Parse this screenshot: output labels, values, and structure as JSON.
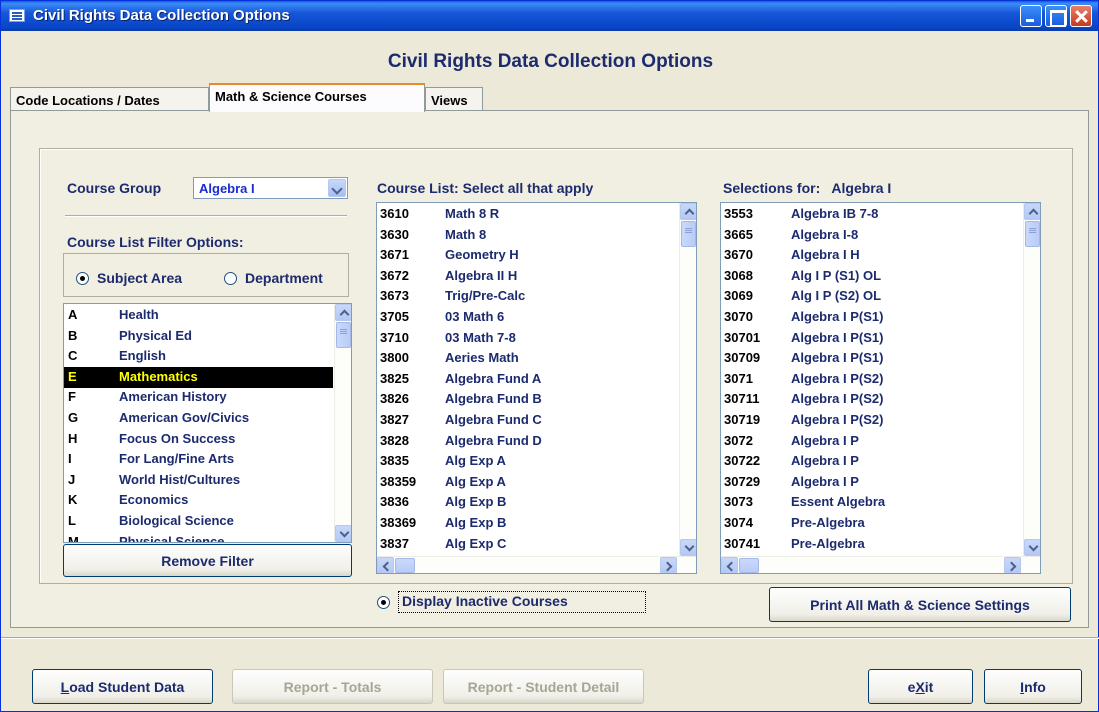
{
  "window": {
    "title": "Civil Rights Data Collection Options"
  },
  "form_title": "Civil Rights Data Collection Options",
  "tabs": [
    {
      "label": "Code Locations / Dates"
    },
    {
      "label": "Math & Science Courses",
      "active": true
    },
    {
      "label": "Views"
    }
  ],
  "course_group": {
    "label": "Course Group",
    "value": "Algebra I"
  },
  "filter": {
    "label": "Course List Filter Options:",
    "subject_area": "Subject Area",
    "department": "Department",
    "selected": "Subject Area",
    "items": [
      {
        "code": "A",
        "name": "Health"
      },
      {
        "code": "B",
        "name": "Physical Ed"
      },
      {
        "code": "C",
        "name": "English"
      },
      {
        "code": "E",
        "name": "Mathematics",
        "selected": true
      },
      {
        "code": "F",
        "name": "American History"
      },
      {
        "code": "G",
        "name": "American Gov/Civics"
      },
      {
        "code": "H",
        "name": "Focus On Success"
      },
      {
        "code": "I",
        "name": "For Lang/Fine Arts"
      },
      {
        "code": "J",
        "name": "World Hist/Cultures"
      },
      {
        "code": "K",
        "name": "Economics"
      },
      {
        "code": "L",
        "name": "Biological Science"
      },
      {
        "code": "M",
        "name": "Physical Science"
      }
    ],
    "remove_filter": "Remove Filter"
  },
  "course_list": {
    "label": "Course List: Select all that apply",
    "items": [
      {
        "code": "3610",
        "name": "Math 8 R"
      },
      {
        "code": "3630",
        "name": "Math 8"
      },
      {
        "code": "3671",
        "name": "Geometry H"
      },
      {
        "code": "3672",
        "name": "Algebra II H"
      },
      {
        "code": "3673",
        "name": "Trig/Pre-Calc"
      },
      {
        "code": "3705",
        "name": "03 Math 6"
      },
      {
        "code": "3710",
        "name": "03 Math 7-8"
      },
      {
        "code": "3800",
        "name": "Aeries Math"
      },
      {
        "code": "3825",
        "name": "Algebra Fund A"
      },
      {
        "code": "3826",
        "name": "Algebra Fund B"
      },
      {
        "code": "3827",
        "name": "Algebra Fund C"
      },
      {
        "code": "3828",
        "name": "Algebra Fund D"
      },
      {
        "code": "3835",
        "name": "Alg Exp A"
      },
      {
        "code": "38359",
        "name": "Alg Exp A"
      },
      {
        "code": "3836",
        "name": "Alg Exp B"
      },
      {
        "code": "38369",
        "name": "Alg Exp B"
      },
      {
        "code": "3837",
        "name": "Alg Exp C"
      }
    ]
  },
  "selections": {
    "label": "Selections for:",
    "group": "Algebra I",
    "items": [
      {
        "code": "3553",
        "name": "Algebra IB 7-8"
      },
      {
        "code": "3665",
        "name": "Algebra I-8"
      },
      {
        "code": "3670",
        "name": "Algebra I H"
      },
      {
        "code": "3068",
        "name": "Alg I P (S1) OL"
      },
      {
        "code": "3069",
        "name": "Alg I P (S2) OL"
      },
      {
        "code": "3070",
        "name": "Algebra I P(S1)"
      },
      {
        "code": "30701",
        "name": "Algebra I P(S1)"
      },
      {
        "code": "30709",
        "name": "Algebra I P(S1)"
      },
      {
        "code": "3071",
        "name": "Algebra I P(S2)"
      },
      {
        "code": "30711",
        "name": "Algebra I P(S2)"
      },
      {
        "code": "30719",
        "name": "Algebra I P(S2)"
      },
      {
        "code": "3072",
        "name": "Algebra I P"
      },
      {
        "code": "30722",
        "name": "Algebra I P"
      },
      {
        "code": "30729",
        "name": "Algebra I P"
      },
      {
        "code": "3073",
        "name": "Essent Algebra"
      },
      {
        "code": "3074",
        "name": "Pre-Algebra"
      },
      {
        "code": "30741",
        "name": "Pre-Algebra"
      }
    ]
  },
  "display_inactive": {
    "label": "Display Inactive Courses",
    "checked": true
  },
  "buttons": {
    "print_all": "Print All Math & Science Settings",
    "load_student_data": {
      "mnemonic": "L",
      "rest": "oad Student Data"
    },
    "report_totals": "Report - Totals",
    "report_student_detail": "Report - Student Detail",
    "exit": {
      "before": "e",
      "mnemonic": "X",
      "after": "it"
    },
    "info": {
      "mnemonic": "I",
      "rest": "nfo"
    }
  }
}
